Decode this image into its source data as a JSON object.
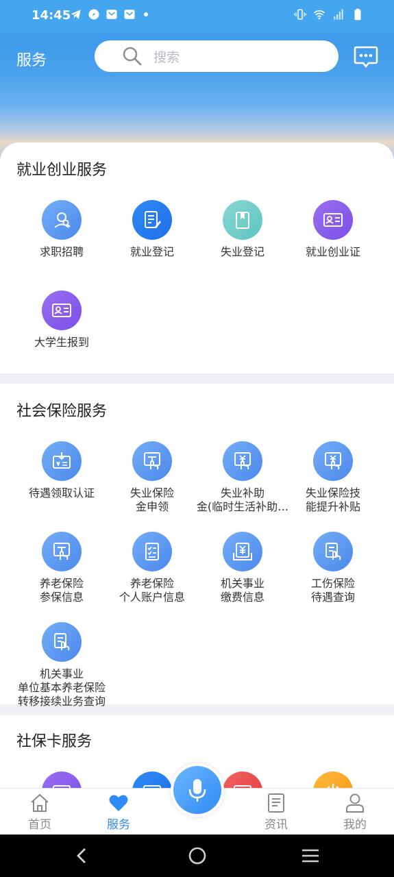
{
  "status_bar": {
    "time": "14:45",
    "icons": [
      "telegram-icon",
      "compass-icon",
      "mail-icon",
      "mail-icon",
      "dot-icon",
      "vibrate-icon",
      "wifi-icon",
      "signal-icon",
      "battery-icon"
    ]
  },
  "header": {
    "title": "服务",
    "search_placeholder": "搜索",
    "chat_icon": "chat-bubble-icon"
  },
  "sections": [
    {
      "title": "就业创业服务",
      "items": [
        {
          "label": "求职招聘",
          "icon": "job-search-icon",
          "color": "#5b96ee"
        },
        {
          "label": "就业登记",
          "icon": "edit-doc-icon",
          "color": "#2f8af5"
        },
        {
          "label": "失业登记",
          "icon": "book-icon",
          "color": "#6ecdc9"
        },
        {
          "label": "就业创业证",
          "icon": "id-card-icon",
          "color": "#8a5eee"
        },
        {
          "label": "大学生报到",
          "icon": "id-card-icon",
          "color": "#8a5eee"
        }
      ]
    },
    {
      "title": "社会保险服务",
      "items": [
        {
          "label": "待遇领取认证",
          "line2": "",
          "icon": "certificate-icon"
        },
        {
          "label": "失业保险",
          "line2": "金申领",
          "icon": "hand-doc-icon"
        },
        {
          "label": "失业补助",
          "line2": "金(临时生活补助…",
          "icon": "hand-money-icon"
        },
        {
          "label": "失业保险技",
          "line2": "能提升补贴",
          "icon": "hand-money-icon"
        },
        {
          "label": "养老保险",
          "line2": "参保信息",
          "icon": "hand-doc-icon"
        },
        {
          "label": "养老保险",
          "line2": "个人账户信息",
          "icon": "checklist-icon"
        },
        {
          "label": "机关事业",
          "line2": "缴费信息",
          "icon": "yuan-doc-icon"
        },
        {
          "label": "工伤保险",
          "line2": "待遇查询",
          "icon": "hand-doc-icon"
        },
        {
          "label": "机关事业",
          "line2": "单位基本养老保险",
          "line3": "转移接续业务查询",
          "icon": "hand-doc-icon"
        }
      ]
    },
    {
      "title": "社保卡服务",
      "items": [
        {
          "icon": "card-icon",
          "color": "#8a5eee"
        },
        {
          "icon": "card-icon",
          "color": "#2f8af5"
        },
        {
          "icon": "card-icon",
          "color": "#e84848"
        },
        {
          "icon": "power-icon",
          "color": "#f5a623"
        }
      ]
    }
  ],
  "bottom_nav": {
    "items": [
      {
        "label": "首页",
        "icon": "home-icon",
        "active": false
      },
      {
        "label": "服务",
        "icon": "heart-icon",
        "active": true
      },
      {
        "label": "资讯",
        "icon": "news-icon",
        "active": false
      },
      {
        "label": "我的",
        "icon": "user-icon",
        "active": false
      }
    ],
    "mic_icon": "microphone-icon"
  },
  "system_nav": [
    "back-icon",
    "home-circle-icon",
    "menu-icon"
  ],
  "colors": {
    "primary": "#2f8af5",
    "status_bar": "#43a6ef",
    "background": "#eef0f3"
  }
}
